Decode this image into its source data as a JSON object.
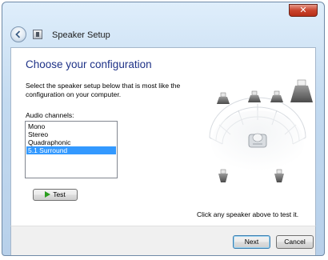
{
  "window": {
    "title": "Speaker Setup",
    "close_glyph": "✕"
  },
  "content": {
    "heading": "Choose your configuration",
    "description": "Select the speaker setup below that is most like the configuration on your computer.",
    "channels_label": "Audio channels:",
    "channels": [
      "Mono",
      "Stereo",
      "Quadraphonic",
      "5.1 Surround"
    ],
    "selected_channel": "5.1 Surround",
    "test_label": "Test",
    "hint": "Click any speaker above to test it."
  },
  "footer": {
    "next_label": "Next",
    "cancel_label": "Cancel"
  },
  "colors": {
    "heading": "#1e3287",
    "selection": "#3399ff",
    "play_icon": "#2a9d1f"
  },
  "icons": {
    "back": "back-arrow-icon",
    "app": "speaker-setup-icon",
    "play": "play-icon",
    "speaker": "speaker-icon"
  }
}
